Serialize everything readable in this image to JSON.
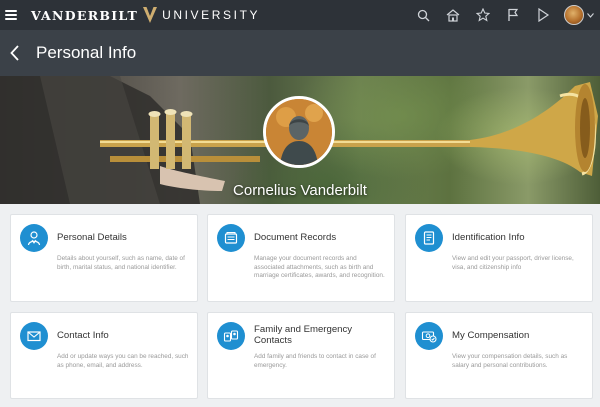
{
  "brand": {
    "left": "VANDERBILT",
    "right": "UNIVERSITY"
  },
  "icons": {
    "menu": "hamburger-menu-icon",
    "search": "search-icon",
    "home": "home-icon",
    "favorites": "star-icon",
    "notifications": "flag-icon",
    "signout": "signout-icon",
    "avatar": "avatar"
  },
  "page": {
    "title": "Personal Info"
  },
  "profile": {
    "name": "Cornelius Vanderbilt"
  },
  "cards": [
    {
      "title": "Personal Details",
      "desc": "Details about yourself, such as name, date of birth, marital status, and national identifier.",
      "icon": "person-icon"
    },
    {
      "title": "Document Records",
      "desc": "Manage your document records and associated attachments, such as birth and marriage certificates, awards, and recognition.",
      "icon": "document-records-icon"
    },
    {
      "title": "Identification Info",
      "desc": "View and edit your passport, driver license, visa, and citizenship info",
      "icon": "id-card-icon"
    },
    {
      "title": "Contact Info",
      "desc": "Add or update ways you can be reached, such as phone, email, and address.",
      "icon": "envelope-icon"
    },
    {
      "title": "Family and Emergency Contacts",
      "desc": "Add family and friends to contact in case of emergency.",
      "icon": "family-contacts-icon"
    },
    {
      "title": "My Compensation",
      "desc": "View your compensation details, such as salary and personal contributions.",
      "icon": "compensation-icon"
    }
  ],
  "colors": {
    "topbar": "#2d3238",
    "titlebar": "#3b4148",
    "accent": "#1f8fd1",
    "gold": "#cfae70"
  }
}
